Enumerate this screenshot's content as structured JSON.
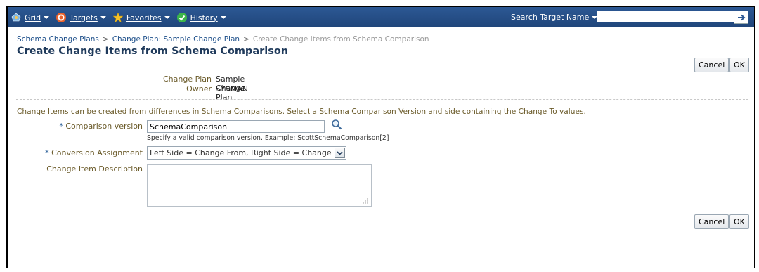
{
  "nav": {
    "menus": [
      {
        "label": "Grid",
        "icon": "grid-icon"
      },
      {
        "label": "Targets",
        "icon": "targets-icon"
      },
      {
        "label": "Favorites",
        "icon": "favorites-star-icon"
      },
      {
        "label": "History",
        "icon": "history-icon"
      }
    ],
    "search_label": "Search Target Name",
    "search_value": "",
    "go_icon": "arrow-right-icon"
  },
  "breadcrumb": {
    "items": [
      "Schema Change Plans",
      "Change Plan: Sample Change Plan"
    ],
    "current": "Create Change Items from Schema Comparison",
    "separator": ">"
  },
  "page": {
    "title": "Create Change Items from Schema Comparison"
  },
  "buttons": {
    "cancel": "Cancel",
    "ok": "OK"
  },
  "plan_info": {
    "change_plan_label": "Change Plan",
    "change_plan_value": "Sample Change Plan",
    "owner_label": "Owner",
    "owner_value": "SYSMAN"
  },
  "instructions": "Change Items can be created from differences in Schema Comparisons. Select a Schema Comparison Version and side containing the Change To values.",
  "form": {
    "required_mark": "*",
    "comparison_version_label": "Comparison version",
    "comparison_version_value": "SchemaComparison",
    "comparison_version_hint": "Specify a valid comparison version. Example: ScottSchemaComparison[2]",
    "conversion_assignment_label": "Conversion Assignment",
    "conversion_assignment_value": "Left Side = Change From, Right Side = Change To",
    "description_label": "Change Item Description",
    "description_value": ""
  },
  "colors": {
    "header_bg": "#2c5894",
    "label_text": "#6b5b2a",
    "title_text": "#1f3a5b",
    "link": "#1d4f8a"
  }
}
